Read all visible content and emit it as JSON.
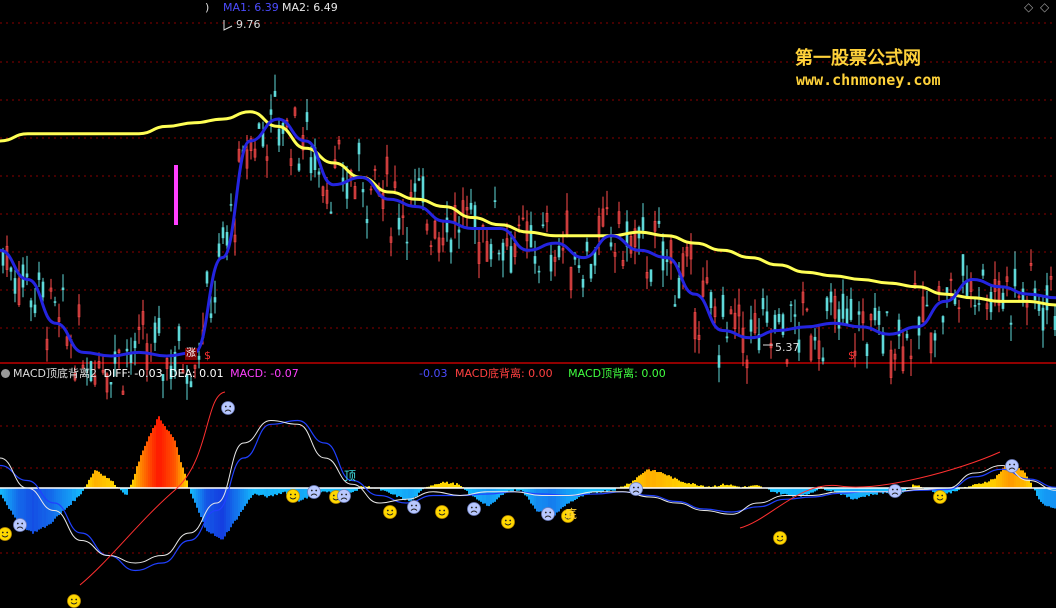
{
  "header": {
    "paren": ")",
    "ma1_label": "MA1: 6.39",
    "ma2_label": "MA2: 6.49"
  },
  "watermark": {
    "title": "第一股票公式网",
    "url": "www.chnmoney.com"
  },
  "top_controls": {
    "diamond_left": "◇",
    "diamond_right": "◇"
  },
  "annotations": {
    "high": "9.76",
    "low": "5.37",
    "zhang": "涨",
    "s_mark": "$",
    "s_mark2": "$",
    "top_div_tag": "顶",
    "bottom_div_tag": "底"
  },
  "indicator": {
    "name": "MACD顶底背离2",
    "diff_label": "DIFF: -0.03",
    "dea_label": "DEA: 0.01",
    "macd_label": "MACD: -0.07",
    "value2_label": "-0.03",
    "bottom_div_label": "MACD底背离: 0.00",
    "top_div_label": "MACD顶背离: 0.00"
  },
  "colors": {
    "up": "#ff4b4b",
    "down": "#5fd9d9",
    "ma1": "#2424e0",
    "ma2": "#ffff55",
    "diff": "#e8e8e8",
    "dea": "#2040ff",
    "grid": "#8a0000",
    "separator": "#c00000",
    "diff_text": "#ffffff",
    "macd_text": "#ff40ff",
    "blue_text": "#4c4cff",
    "red_text": "#ff4040",
    "green_text": "#40ff40"
  },
  "chart_data": [
    {
      "type": "candlestick",
      "ma_series": [
        {
          "name": "MA1",
          "values": [
            6.6,
            6.2,
            5.6,
            5.2,
            5.15,
            5.2,
            5.15,
            5.2,
            6.5,
            8.1,
            8.4,
            8.1,
            7.5,
            7.6,
            7.3,
            7.2,
            7.0,
            6.9,
            6.9,
            6.6,
            6.7,
            6.5,
            6.8,
            6.6,
            6.5,
            6.0,
            5.5,
            5.4,
            5.5,
            5.55,
            5.6,
            5.55,
            5.45,
            5.55,
            5.9,
            6.2,
            6.1,
            6.0,
            5.95
          ]
        },
        {
          "name": "MA2",
          "values": [
            8.1,
            8.2,
            8.2,
            8.2,
            8.2,
            8.2,
            8.3,
            8.35,
            8.4,
            8.5,
            8.3,
            8.0,
            7.8,
            7.6,
            7.4,
            7.3,
            7.2,
            7.05,
            6.95,
            6.85,
            6.8,
            6.8,
            6.8,
            6.85,
            6.8,
            6.7,
            6.6,
            6.5,
            6.4,
            6.3,
            6.25,
            6.2,
            6.15,
            6.1,
            6.0,
            5.95,
            5.9,
            5.9,
            5.85
          ]
        }
      ],
      "annotated_high": 9.76,
      "annotated_low": 5.37
    },
    {
      "type": "bar",
      "series": [
        {
          "name": "MACD",
          "values": [
            -0.08,
            -0.45,
            -0.6,
            -0.5,
            -0.3,
            -0.1,
            0.25,
            0.1,
            -0.1,
            0.5,
            0.95,
            0.65,
            -0.05,
            -0.55,
            -0.7,
            -0.4,
            -0.08,
            -0.12,
            -0.05,
            -0.18,
            -0.05,
            -0.06,
            -0.1,
            0.03,
            -0.02,
            -0.1,
            -0.18,
            0.02,
            0.08,
            0.05,
            -0.12,
            -0.25,
            -0.05,
            -0.02,
            -0.3,
            -0.38,
            -0.2,
            -0.1,
            -0.05,
            -0.02,
            0.08,
            0.25,
            0.2,
            0.1,
            0.05,
            0.02,
            0.05,
            0.01,
            0.03,
            -0.05,
            -0.1,
            -0.1,
            0.0,
            -0.05,
            -0.15,
            -0.1,
            -0.06,
            -0.08,
            0.05,
            -0.04,
            -0.08,
            0.0,
            0.05,
            0.12,
            0.35,
            0.2,
            -0.2,
            -0.3
          ]
        },
        {
          "name": "DIFF",
          "values": [
            0.4,
            0.0,
            -0.3,
            -0.7,
            -0.9,
            -1.0,
            -0.9,
            -0.6,
            -0.2,
            0.6,
            0.9,
            0.85,
            0.4,
            0.05,
            -0.2,
            -0.15,
            -0.05,
            -0.1,
            -0.05,
            -0.05,
            -0.1,
            -0.1,
            -0.05,
            -0.05,
            -0.12,
            -0.2,
            -0.3,
            -0.35,
            -0.2,
            -0.1,
            -0.1,
            -0.05,
            -0.05,
            -0.05,
            -0.02,
            0.0,
            0.2,
            0.3,
            0.1,
            -0.03
          ]
        },
        {
          "name": "DEA",
          "values": [
            0.3,
            0.1,
            -0.2,
            -0.6,
            -0.9,
            -1.1,
            -1.0,
            -0.7,
            -0.3,
            0.4,
            0.85,
            0.9,
            0.6,
            0.1,
            -0.1,
            -0.2,
            -0.1,
            -0.1,
            -0.08,
            -0.05,
            -0.08,
            -0.1,
            -0.08,
            -0.05,
            -0.1,
            -0.18,
            -0.28,
            -0.32,
            -0.25,
            -0.15,
            -0.12,
            -0.07,
            -0.05,
            -0.05,
            -0.03,
            -0.02,
            0.15,
            0.25,
            0.12,
            0.01
          ]
        }
      ],
      "ylim": [
        -1.15,
        1.0
      ]
    }
  ]
}
